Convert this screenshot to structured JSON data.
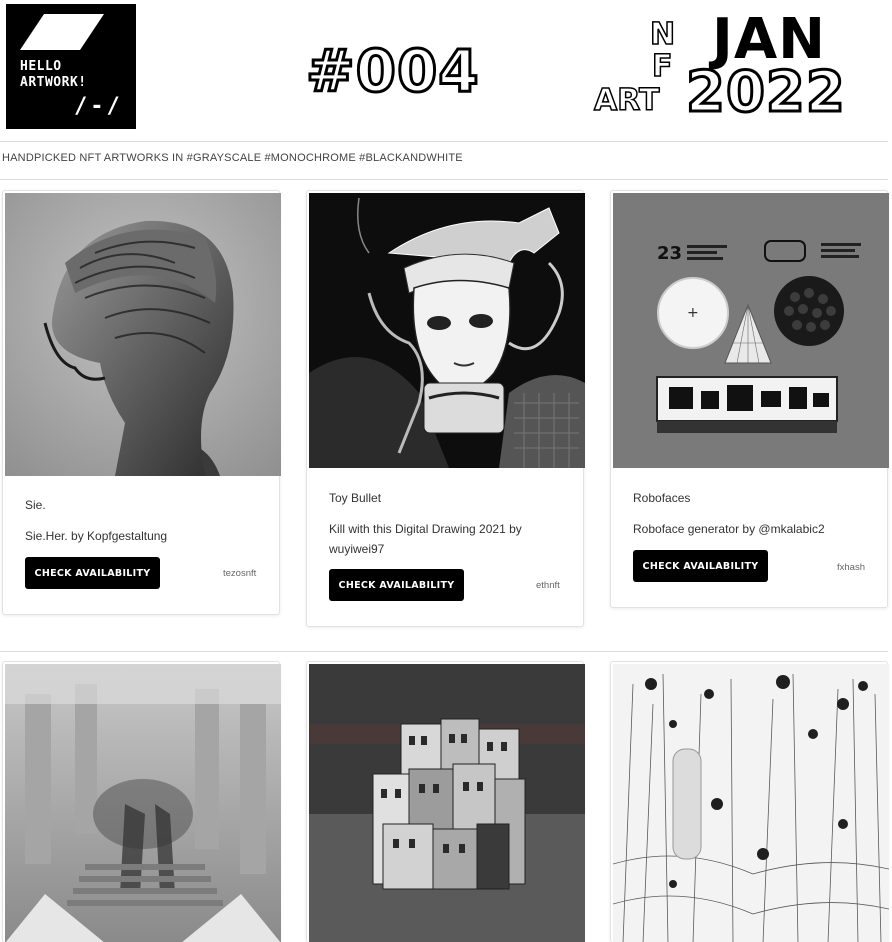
{
  "header": {
    "logo_line1": "HELLO",
    "logo_line2": "ARTWORK!",
    "logo_mark": "/-/",
    "issue": "#004",
    "nf_n": "N",
    "nf_f": "F",
    "nf_art": "ART",
    "month": "JAN",
    "year": "2022"
  },
  "tagline": "HANDPICKED NFT ARTWORKS IN #GRAYSCALE #MONOCHROME #BLACKANDWHITE",
  "cards": [
    {
      "title": "Sie.",
      "description": "Sie.Her. by Kopfgestaltung",
      "button": "CHECK AVAILABILITY",
      "platform": "tezosnft"
    },
    {
      "title": "Toy Bullet",
      "description": "Kill with this Digital Drawing 2021 by wuyiwei97",
      "button": "CHECK AVAILABILITY",
      "platform": "ethnft"
    },
    {
      "title": "Robofaces",
      "description": "Roboface generator by @mkalabic2",
      "button": "CHECK AVAILABILITY",
      "platform": "fxhash"
    }
  ],
  "art_labels": {
    "robofaces_number": "23"
  },
  "colors": {
    "accent": "#000000",
    "card_border": "#e2e2e2",
    "rule": "#dcdcdc"
  }
}
